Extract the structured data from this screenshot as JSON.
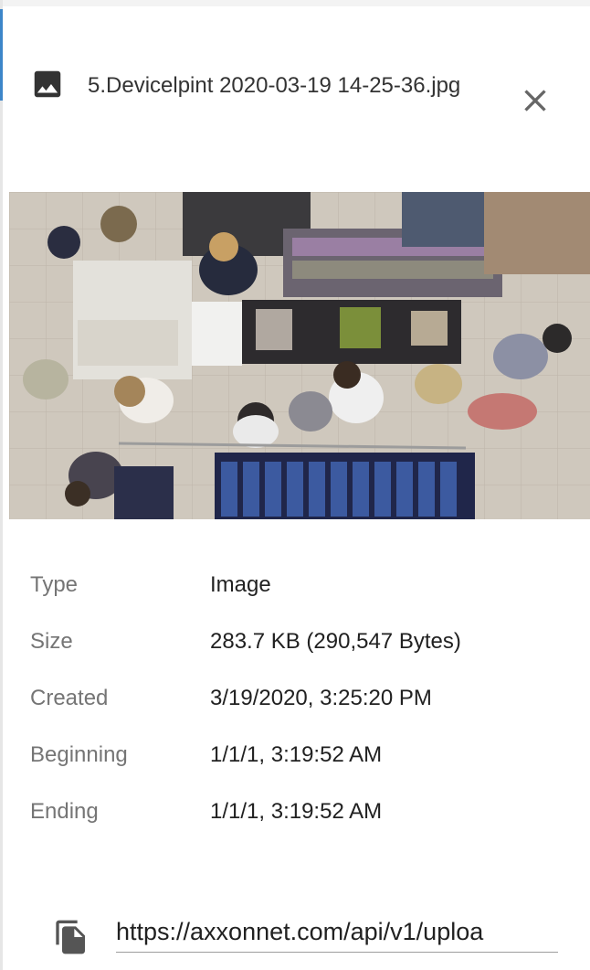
{
  "header": {
    "icon": "image-icon",
    "file_name": "5.Devicelpint 2020-03-19 14-25-36.jpg",
    "close_icon": "close-icon"
  },
  "preview": {
    "description_icon": "camera-snapshot"
  },
  "properties": [
    {
      "label": "Type",
      "value": "Image"
    },
    {
      "label": "Size",
      "value": "283.7 KB (290,547 Bytes)"
    },
    {
      "label": "Created",
      "value": "3/19/2020, 3:25:20 PM"
    },
    {
      "label": "Beginning",
      "value": "1/1/1, 3:19:52 AM"
    },
    {
      "label": "Ending",
      "value": "1/1/1, 3:19:52 AM"
    }
  ],
  "link": {
    "icon": "copy-icon",
    "url": "https://axxonnet.com/api/v1/uploa"
  },
  "colors": {
    "accent": "#3d86c9",
    "label": "#757575",
    "text": "#212121"
  }
}
